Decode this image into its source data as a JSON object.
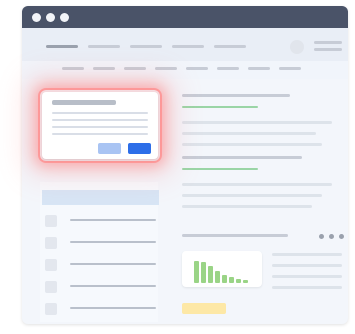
{
  "window": {
    "titlebar_color": "#4a5368",
    "controls": [
      "window-dot-1",
      "window-dot-2",
      "window-dot-3"
    ]
  },
  "modal": {
    "highlight_color": "#ff5a5a",
    "primary_button_color": "#2d6ee8",
    "secondary_button_color": "#a9c4f3"
  },
  "chart": {
    "bar_color": "#9ad486",
    "bar_levels": [
      1.0,
      0.95,
      0.75,
      0.55,
      0.35,
      0.25,
      0.18,
      0.12
    ]
  },
  "tag": {
    "color": "#fde8a6"
  }
}
